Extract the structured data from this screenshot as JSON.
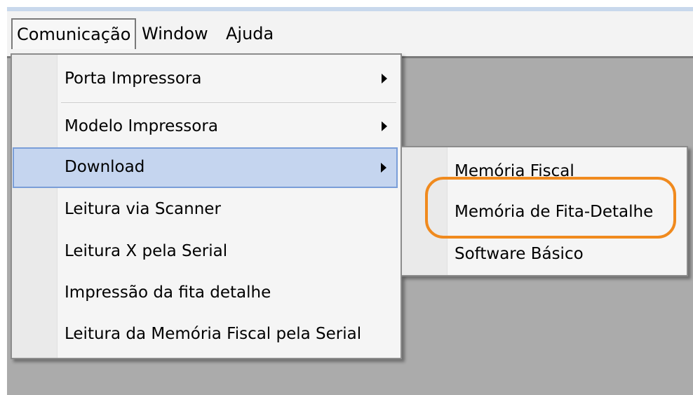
{
  "menubar": {
    "items": [
      {
        "label": "Comunicação",
        "active": true
      },
      {
        "label": "Window",
        "active": false
      },
      {
        "label": "Ajuda",
        "active": false
      }
    ]
  },
  "comunicacao_menu": {
    "items": [
      {
        "label": "Porta Impressora",
        "has_submenu": true
      },
      {
        "label": "Modelo Impressora",
        "has_submenu": true
      },
      {
        "label": "Download",
        "has_submenu": true,
        "highlighted": true
      },
      {
        "label": "Leitura via Scanner",
        "has_submenu": false
      },
      {
        "label": "Leitura X pela Serial",
        "has_submenu": false
      },
      {
        "label": "Impressão da fita detalhe",
        "has_submenu": false
      },
      {
        "label": "Leitura da Memória Fiscal pela Serial",
        "has_submenu": false
      }
    ]
  },
  "download_submenu": {
    "items": [
      {
        "label": "Memória Fiscal"
      },
      {
        "label": "Memória de Fita-Detalhe",
        "annotated": true
      },
      {
        "label": "Software Básico"
      }
    ]
  },
  "colors": {
    "highlight_fill": "#c5d5ef",
    "highlight_border": "#7a9ed8",
    "annotation": "#f08a1e",
    "workspace": "#ababab"
  }
}
